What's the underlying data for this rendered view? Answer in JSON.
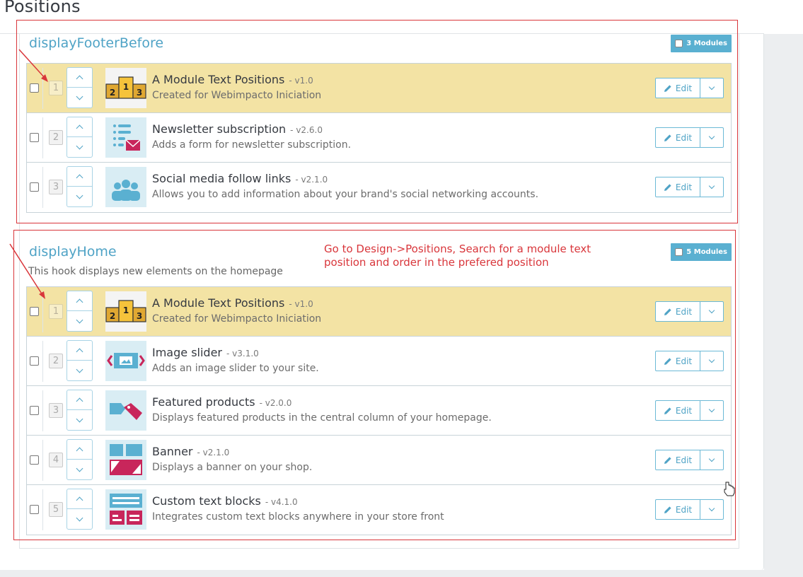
{
  "page": {
    "title": "Positions"
  },
  "colors": {
    "accent": "#4fa3c6",
    "highlight_row": "#f3e3a4",
    "annotation": "#d9363b",
    "badge": "#5ab0d1"
  },
  "annotation": {
    "line1": "Go to Design->Positions, Search for a module text",
    "line2": "position and order in the prefered position"
  },
  "hooks": [
    {
      "name": "displayFooterBefore",
      "description": "",
      "badge": "3 Modules",
      "modules": [
        {
          "position": "1",
          "name": "A Module Text Positions",
          "version": "- v1.0",
          "description": "Created for Webimpacto Iniciation",
          "icon": "podium-icon",
          "edit": "Edit",
          "highlighted": true
        },
        {
          "position": "2",
          "name": "Newsletter subscription",
          "version": "- v2.6.0",
          "description": "Adds a form for newsletter subscription.",
          "icon": "newsletter-icon",
          "edit": "Edit",
          "highlighted": false
        },
        {
          "position": "3",
          "name": "Social media follow links",
          "version": "- v2.1.0",
          "description": "Allows you to add information about your brand's social networking accounts.",
          "icon": "social-people-icon",
          "edit": "Edit",
          "highlighted": false
        }
      ]
    },
    {
      "name": "displayHome",
      "description": "This hook displays new elements on the homepage",
      "badge": "5 Modules",
      "modules": [
        {
          "position": "1",
          "name": "A Module Text Positions",
          "version": "- v1.0",
          "description": "Created for Webimpacto Iniciation",
          "icon": "podium-icon",
          "edit": "Edit",
          "highlighted": true
        },
        {
          "position": "2",
          "name": "Image slider",
          "version": "- v3.1.0",
          "description": "Adds an image slider to your site.",
          "icon": "image-slider-icon",
          "edit": "Edit",
          "highlighted": false
        },
        {
          "position": "3",
          "name": "Featured products",
          "version": "- v2.0.0",
          "description": "Displays featured products in the central column of your homepage.",
          "icon": "featured-tags-icon",
          "edit": "Edit",
          "highlighted": false
        },
        {
          "position": "4",
          "name": "Banner",
          "version": "- v2.1.0",
          "description": "Displays a banner on your shop.",
          "icon": "banner-icon",
          "edit": "Edit",
          "highlighted": false
        },
        {
          "position": "5",
          "name": "Custom text blocks",
          "version": "- v4.1.0",
          "description": "Integrates custom text blocks anywhere in your store front",
          "icon": "custom-text-icon",
          "edit": "Edit",
          "highlighted": false
        }
      ]
    }
  ]
}
